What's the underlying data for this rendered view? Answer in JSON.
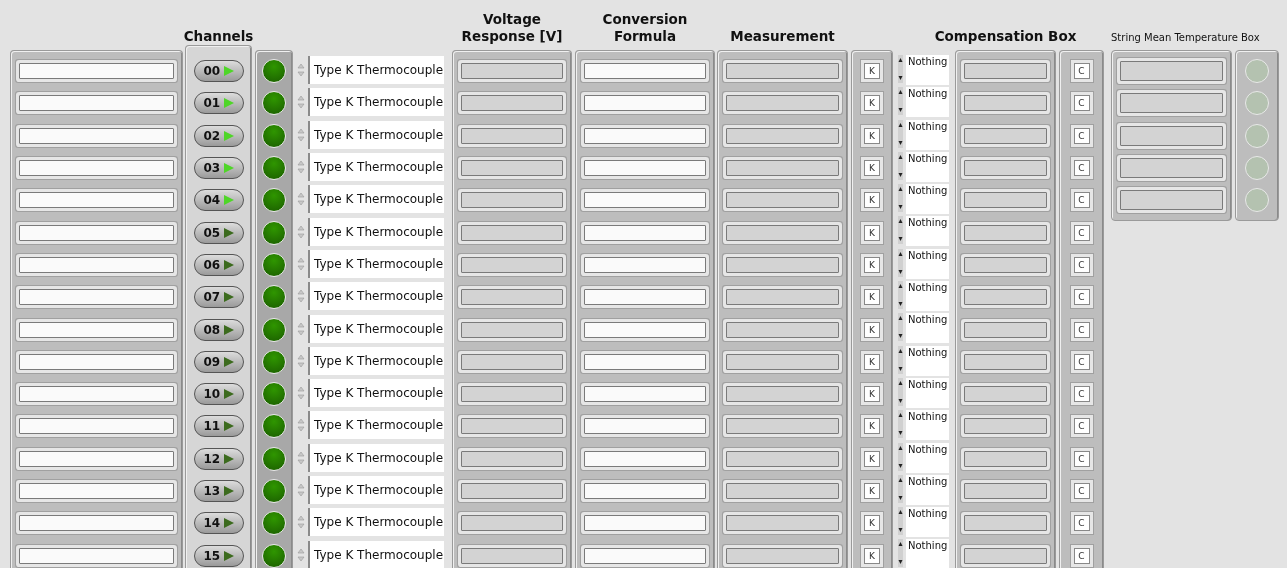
{
  "headings": {
    "channels": "Channels",
    "voltage": "Voltage Response [V]",
    "formula": "Conversion Formula",
    "measurement": "Measurement",
    "compensation": "Compensation Box",
    "string_mean": "String Mean Temperature Box"
  },
  "rows": [
    {
      "channel": "00",
      "on": true,
      "lit": true,
      "type": "Type K Thermocouple",
      "unit": "K",
      "selection": "Nothing",
      "comp_unit": "C"
    },
    {
      "channel": "01",
      "on": true,
      "lit": true,
      "type": "Type K Thermocouple",
      "unit": "K",
      "selection": "Nothing",
      "comp_unit": "C"
    },
    {
      "channel": "02",
      "on": true,
      "lit": true,
      "type": "Type K Thermocouple",
      "unit": "K",
      "selection": "Nothing",
      "comp_unit": "C"
    },
    {
      "channel": "03",
      "on": true,
      "lit": true,
      "type": "Type K Thermocouple",
      "unit": "K",
      "selection": "Nothing",
      "comp_unit": "C"
    },
    {
      "channel": "04",
      "on": true,
      "lit": true,
      "type": "Type K Thermocouple",
      "unit": "K",
      "selection": "Nothing",
      "comp_unit": "C"
    },
    {
      "channel": "05",
      "on": false,
      "lit": true,
      "type": "Type K Thermocouple",
      "unit": "K",
      "selection": "Nothing",
      "comp_unit": "C"
    },
    {
      "channel": "06",
      "on": false,
      "lit": true,
      "type": "Type K Thermocouple",
      "unit": "K",
      "selection": "Nothing",
      "comp_unit": "C"
    },
    {
      "channel": "07",
      "on": false,
      "lit": true,
      "type": "Type K Thermocouple",
      "unit": "K",
      "selection": "Nothing",
      "comp_unit": "C"
    },
    {
      "channel": "08",
      "on": false,
      "lit": true,
      "type": "Type K Thermocouple",
      "unit": "K",
      "selection": "Nothing",
      "comp_unit": "C"
    },
    {
      "channel": "09",
      "on": false,
      "lit": true,
      "type": "Type K Thermocouple",
      "unit": "K",
      "selection": "Nothing",
      "comp_unit": "C"
    },
    {
      "channel": "10",
      "on": false,
      "lit": true,
      "type": "Type K Thermocouple",
      "unit": "K",
      "selection": "Nothing",
      "comp_unit": "C"
    },
    {
      "channel": "11",
      "on": false,
      "lit": true,
      "type": "Type K Thermocouple",
      "unit": "K",
      "selection": "Nothing",
      "comp_unit": "C"
    },
    {
      "channel": "12",
      "on": false,
      "lit": true,
      "type": "Type K Thermocouple",
      "unit": "K",
      "selection": "Nothing",
      "comp_unit": "C"
    },
    {
      "channel": "13",
      "on": false,
      "lit": true,
      "type": "Type K Thermocouple",
      "unit": "K",
      "selection": "Nothing",
      "comp_unit": "C"
    },
    {
      "channel": "14",
      "on": false,
      "lit": true,
      "type": "Type K Thermocouple",
      "unit": "K",
      "selection": "Nothing",
      "comp_unit": "C"
    },
    {
      "channel": "15",
      "on": false,
      "lit": true,
      "type": "Type K Thermocouple",
      "unit": "K",
      "selection": "Nothing",
      "comp_unit": "C"
    }
  ],
  "string_means": [
    {
      "lit": false
    },
    {
      "lit": false
    },
    {
      "lit": false
    },
    {
      "lit": false
    },
    {
      "lit": false
    }
  ]
}
